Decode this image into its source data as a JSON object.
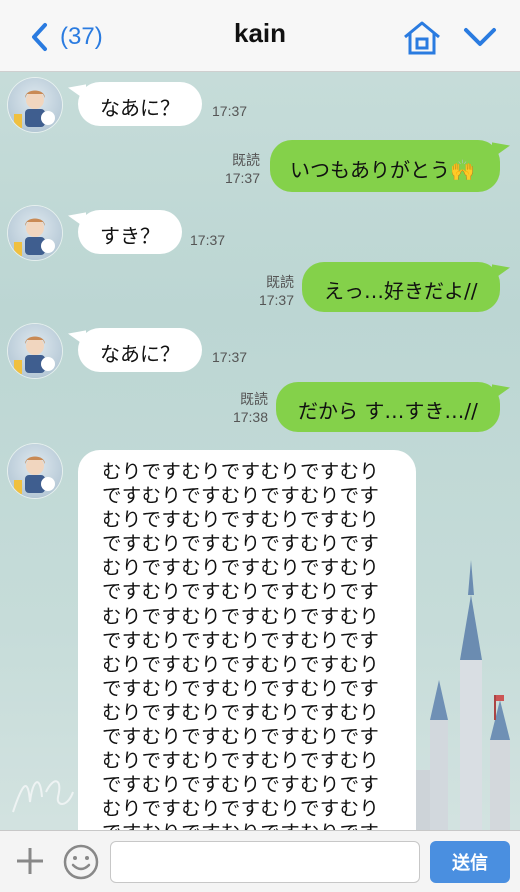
{
  "header": {
    "back_count": "(37)",
    "title": "kain"
  },
  "messages": [
    {
      "side": "in",
      "text": "なあに？",
      "time": "17:37"
    },
    {
      "side": "out",
      "text": "いつもありがとう",
      "emoji": "🙌",
      "read": "既読",
      "time": "17:37"
    },
    {
      "side": "in",
      "text": "すき？",
      "time": "17:37"
    },
    {
      "side": "out",
      "text": "えっ…好きだよ//",
      "read": "既読",
      "time": "17:37"
    },
    {
      "side": "in",
      "text": "なあに？",
      "time": "17:37"
    },
    {
      "side": "out",
      "text": "だから す…すき…//",
      "read": "既読",
      "time": "17:38"
    }
  ],
  "long_message": {
    "lines": [
      "むりですむりですむりですむり",
      "ですむりですむりですむりです",
      "むりですむりですむりですむり",
      "ですむりですむりですむりです",
      "むりですむりですむりですむり",
      "ですむりですむりですむりです",
      "むりですむりですむりですむり",
      "ですむりですむりですむりです",
      "むりですむりですむりですむり",
      "ですむりですむりですむりです",
      "むりですむりですむりですむり",
      "ですむりですむりですむりです",
      "むりですむりですむりですむり",
      "ですむりですむりですむりです",
      "むりですむりですむりですむり",
      "ですむりですむりですむりです"
    ]
  },
  "footer": {
    "input_value": "",
    "send_label": "送信"
  },
  "colors": {
    "accent": "#2a7be0",
    "outgoing_bubble": "#84d14a",
    "incoming_bubble": "#ffffff",
    "send_button": "#4a8fe0"
  },
  "icons": [
    "back-chevron-icon",
    "home-icon",
    "chevron-down-icon",
    "plus-icon",
    "emoji-icon"
  ]
}
